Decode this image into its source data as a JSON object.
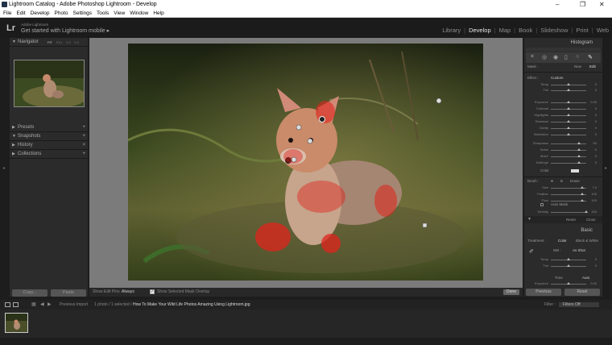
{
  "window": {
    "title": "Lightroom Catalog - Adobe Photoshop Lightroom - Develop",
    "controls": [
      "–",
      "❐",
      "✕"
    ]
  },
  "menu": [
    "File",
    "Edit",
    "Develop",
    "Photo",
    "Settings",
    "Tools",
    "View",
    "Window",
    "Help"
  ],
  "identity": {
    "logo": "Lr",
    "line1": "Adobe Lightroom",
    "line2": "Get started with Lightroom mobile",
    "arrow": "▸"
  },
  "modules": [
    "Library",
    "Develop",
    "Map",
    "Book",
    "Slideshow",
    "Print",
    "Web"
  ],
  "active_module": "Develop",
  "left_panel": {
    "navigator": {
      "label": "Navigator",
      "zoom_options": [
        "FIT",
        "FILL",
        "1:1",
        "1:3"
      ]
    },
    "sections": [
      {
        "label": "Presets",
        "has_plus": true
      },
      {
        "label": "Snapshots",
        "has_plus": true
      },
      {
        "label": "History",
        "has_plus": false
      },
      {
        "label": "Collections",
        "has_plus": true
      }
    ],
    "copy_label": "Copy...",
    "paste_label": "Paste"
  },
  "toolbar": {
    "show_edit_pins_label": "Show Edit Pins :",
    "show_edit_pins_value": "Always",
    "show_mask_overlay": "Show Selected Mask Overlay",
    "done_label": "Done"
  },
  "right_panel": {
    "histogram_label": "Histogram",
    "mask_label": "Mask :",
    "mask_new": "New",
    "mask_edit": "Edit",
    "effect_label": "Effect :",
    "effect_value": "Custom",
    "sliders_a": [
      {
        "label": "Temp",
        "val": "0"
      },
      {
        "label": "Tint",
        "val": "0"
      }
    ],
    "sliders_b": [
      {
        "label": "Exposure",
        "val": "0.00"
      },
      {
        "label": "Contrast",
        "val": "0"
      },
      {
        "label": "Highlights",
        "val": "0"
      },
      {
        "label": "Shadows",
        "val": "0"
      },
      {
        "label": "Clarity",
        "val": "0"
      },
      {
        "label": "Saturation",
        "val": "0"
      }
    ],
    "sliders_c": [
      {
        "label": "Sharpness",
        "val": "50"
      },
      {
        "label": "Noise",
        "val": "0"
      },
      {
        "label": "Moiré",
        "val": "0"
      },
      {
        "label": "Defringe",
        "val": "0"
      }
    ],
    "color_label": "Color",
    "brush": {
      "label": "Brush :",
      "a": "A",
      "b": "B",
      "erase": "Erase"
    },
    "brush_sliders": [
      {
        "label": "Size",
        "val": "7.0"
      },
      {
        "label": "Feather",
        "val": "100"
      },
      {
        "label": "Flow",
        "val": "100"
      }
    ],
    "auto_mask": "Auto Mask",
    "density": {
      "label": "Density",
      "val": "100"
    },
    "reset_label": "Reset",
    "close_label": "Close",
    "basic_label": "Basic",
    "treatment_label": "Treatment :",
    "treatment_color": "Color",
    "treatment_bw": "Black & White",
    "wb_label": "WB :",
    "wb_value": "As Shot",
    "basic_sliders": [
      {
        "label": "Temp",
        "val": "0"
      },
      {
        "label": "Tint",
        "val": "0"
      }
    ],
    "tone_label": "Tone",
    "tone_auto": "Auto",
    "exposure": {
      "label": "Exposure",
      "val": "0.00"
    },
    "previous_label": "Previous",
    "reset_btn_label": "Reset"
  },
  "filmstrip_bar": {
    "previous_import": "Previous Import",
    "count": "1 photo / 1 selected /",
    "filename": "How To Make Your Wild Life Photos Amazing Using Lightroom.jpg",
    "filter_label": "Filter :",
    "filter_value": "Filters Off"
  }
}
